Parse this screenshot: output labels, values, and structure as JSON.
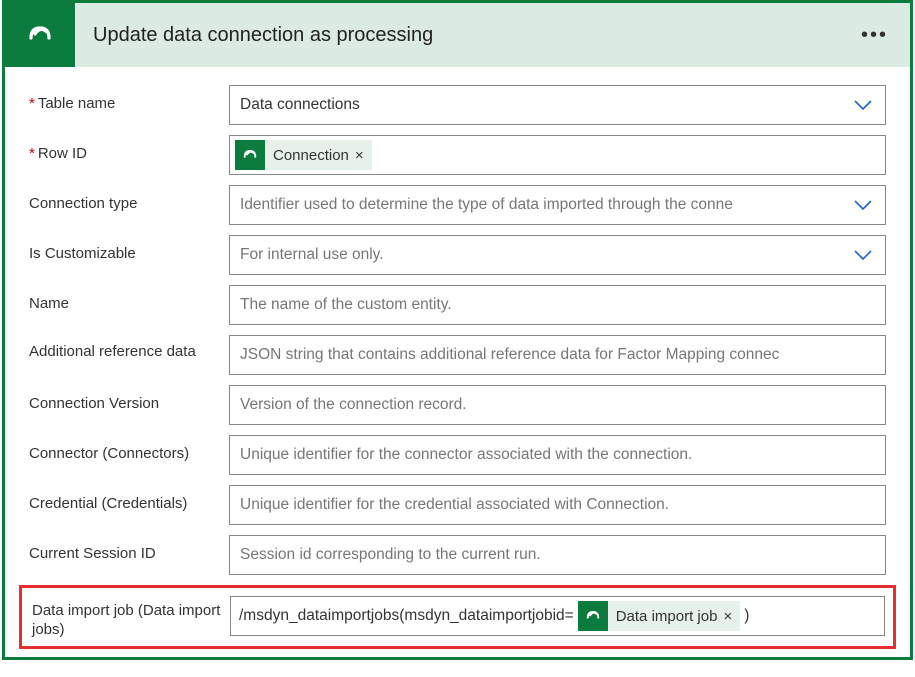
{
  "header": {
    "title": "Update data connection as processing",
    "icon": "dataverse-icon",
    "menu": "more-icon"
  },
  "fields": {
    "tableName": {
      "label": "Table name",
      "required": true,
      "value": "Data connections"
    },
    "rowId": {
      "label": "Row ID",
      "required": true,
      "token": "Connection"
    },
    "connectionType": {
      "label": "Connection type",
      "placeholder": "Identifier used to determine the type of data imported through the conne"
    },
    "isCustomizable": {
      "label": "Is Customizable",
      "placeholder": "For internal use only."
    },
    "name": {
      "label": "Name",
      "placeholder": "The name of the custom entity."
    },
    "additionalRef": {
      "label": "Additional reference data",
      "placeholder": "JSON string that contains additional reference data for Factor Mapping connec"
    },
    "connectionVersion": {
      "label": "Connection Version",
      "placeholder": "Version of the connection record."
    },
    "connector": {
      "label": "Connector (Connectors)",
      "placeholder": "Unique identifier for the connector associated with the connection."
    },
    "credential": {
      "label": "Credential (Credentials)",
      "placeholder": "Unique identifier for the credential associated with Connection."
    },
    "currentSession": {
      "label": "Current Session ID",
      "placeholder": "Session id corresponding to the current run."
    },
    "dataImportJob": {
      "label": "Data import job (Data import jobs)",
      "prefix": "/msdyn_dataimportjobs(msdyn_dataimportjobid=",
      "token": "Data import job",
      "suffix": ")"
    }
  }
}
